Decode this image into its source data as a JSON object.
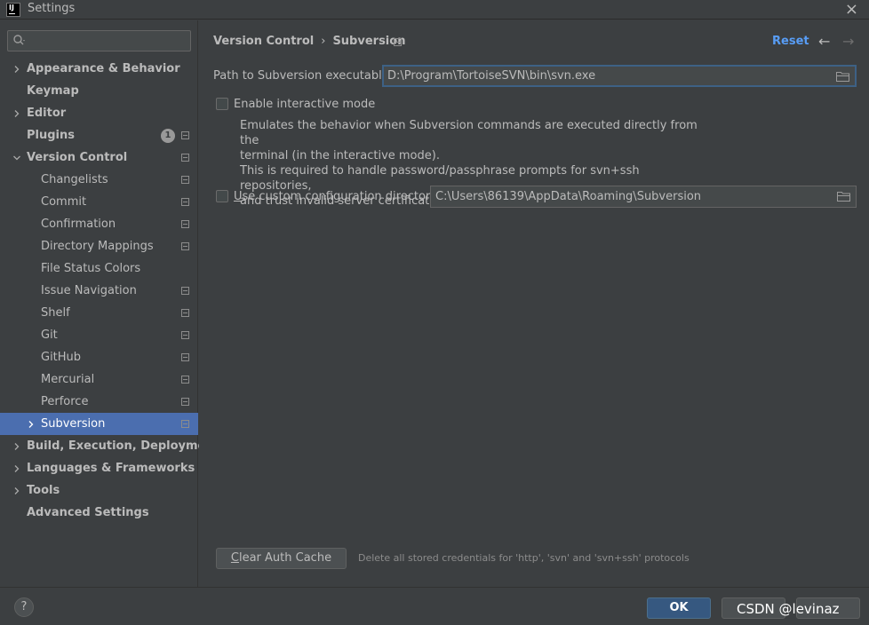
{
  "window": {
    "title": "Settings",
    "app_icon_text": "IJ"
  },
  "sidebar": {
    "search": {
      "value": "",
      "placeholder": ""
    },
    "items": [
      {
        "label": "Appearance & Behavior",
        "level": 0,
        "bold": true,
        "chevron": "right",
        "project_icon": false
      },
      {
        "label": "Keymap",
        "level": 0,
        "bold": true,
        "chevron": "none",
        "project_icon": false
      },
      {
        "label": "Editor",
        "level": 0,
        "bold": true,
        "chevron": "right",
        "project_icon": false
      },
      {
        "label": "Plugins",
        "level": 0,
        "bold": true,
        "chevron": "none",
        "project_icon": true,
        "badge": "1"
      },
      {
        "label": "Version Control",
        "level": 0,
        "bold": true,
        "chevron": "down",
        "project_icon": true
      },
      {
        "label": "Changelists",
        "level": 1,
        "bold": false,
        "chevron": "none",
        "project_icon": true
      },
      {
        "label": "Commit",
        "level": 1,
        "bold": false,
        "chevron": "none",
        "project_icon": true
      },
      {
        "label": "Confirmation",
        "level": 1,
        "bold": false,
        "chevron": "none",
        "project_icon": true
      },
      {
        "label": "Directory Mappings",
        "level": 1,
        "bold": false,
        "chevron": "none",
        "project_icon": true
      },
      {
        "label": "File Status Colors",
        "level": 1,
        "bold": false,
        "chevron": "none",
        "project_icon": false
      },
      {
        "label": "Issue Navigation",
        "level": 1,
        "bold": false,
        "chevron": "none",
        "project_icon": true
      },
      {
        "label": "Shelf",
        "level": 1,
        "bold": false,
        "chevron": "none",
        "project_icon": true
      },
      {
        "label": "Git",
        "level": 1,
        "bold": false,
        "chevron": "none",
        "project_icon": true
      },
      {
        "label": "GitHub",
        "level": 1,
        "bold": false,
        "chevron": "none",
        "project_icon": true
      },
      {
        "label": "Mercurial",
        "level": 1,
        "bold": false,
        "chevron": "none",
        "project_icon": true
      },
      {
        "label": "Perforce",
        "level": 1,
        "bold": false,
        "chevron": "none",
        "project_icon": true
      },
      {
        "label": "Subversion",
        "level": 1,
        "bold": false,
        "chevron": "right",
        "project_icon": true,
        "selected": true
      },
      {
        "label": "Build, Execution, Deployment",
        "level": 0,
        "bold": true,
        "chevron": "right",
        "project_icon": false
      },
      {
        "label": "Languages & Frameworks",
        "level": 0,
        "bold": true,
        "chevron": "right",
        "project_icon": false
      },
      {
        "label": "Tools",
        "level": 0,
        "bold": true,
        "chevron": "right",
        "project_icon": false
      },
      {
        "label": "Advanced Settings",
        "level": 0,
        "bold": true,
        "chevron": "none",
        "project_icon": false
      }
    ]
  },
  "header": {
    "breadcrumb_parent": "Version Control",
    "breadcrumb_separator": "›",
    "breadcrumb_current": "Subversion",
    "reset_label": "Reset",
    "back_arrow": "←",
    "forward_arrow": "→"
  },
  "form": {
    "path_label": "Path to Subversion executable:",
    "path_value": "D:\\Program\\TortoiseSVN\\bin\\svn.exe",
    "interactive_label": "Enable interactive mode",
    "interactive_checked": false,
    "description": [
      "Emulates the behavior when Subversion commands are executed directly from the",
      "terminal (in the interactive mode).",
      "This is required to handle password/passphrase prompts for svn+ssh repositories,",
      "and trust invalid server certificates for https repositories."
    ],
    "custom_dir_label": "Use custom configuration directory:",
    "custom_dir_checked": false,
    "custom_dir_value": "C:\\Users\\86139\\AppData\\Roaming\\Subversion",
    "clear_cache_label": "Clear Auth Cache",
    "clear_cache_hint": "Delete all stored credentials for 'http', 'svn' and 'svn+ssh' protocols"
  },
  "footer": {
    "help_label": "?",
    "ok_label": "OK",
    "cancel_label": "",
    "apply_label": "",
    "watermark": "CSDN @levinaz"
  },
  "colors": {
    "background": "#3c3f41",
    "selection": "#4b6eaf",
    "link": "#589df6",
    "primary_button": "#365880"
  }
}
